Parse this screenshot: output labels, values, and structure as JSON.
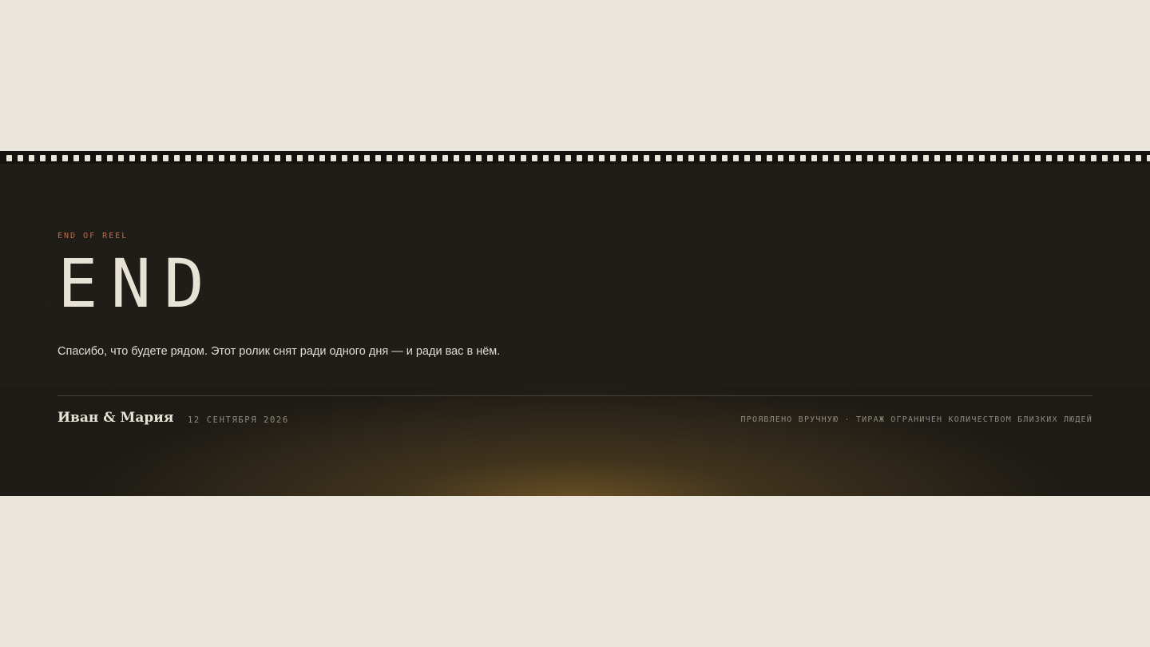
{
  "theme": {
    "page_bg": "#e9e5da",
    "reel_bg": "#1d1b16",
    "accent": "#c9663f",
    "text_light": "#e7e2d6",
    "text_muted": "#8f897c",
    "glow": "#6e5426"
  },
  "reel": {
    "kicker": "END OF REEL",
    "title": "END",
    "thanks": "Спасибо, что будете рядом. Этот ролик снят ради одного дня — и ради вас в нём.",
    "footer": {
      "names": "Иван & Мария",
      "date": "12 СЕНТЯБРЯ 2026",
      "note": "ПРОЯВЛЕНО ВРУЧНУЮ · ТИРАЖ ОГРАНИЧЕН КОЛИЧЕСТВОМ БЛИЗКИХ ЛЮДЕЙ"
    }
  },
  "icons": {
    "sprockets": "film-sprocket-holes"
  }
}
